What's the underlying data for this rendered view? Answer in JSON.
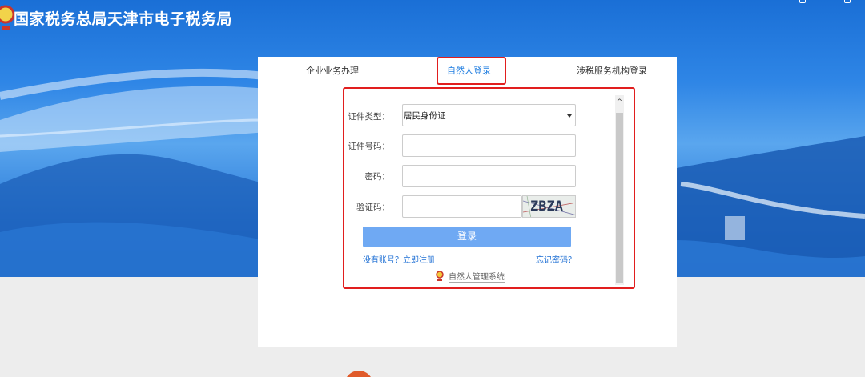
{
  "header": {
    "site_title": "国家税务总局天津市电子税务局"
  },
  "tabs": [
    {
      "label": "企业业务办理"
    },
    {
      "label": "自然人登录",
      "selected": true
    },
    {
      "label": "涉税服务机构登录"
    }
  ],
  "form": {
    "id_type_label": "证件类型：",
    "id_type_value": "居民身份证",
    "id_number_label": "证件号码：",
    "id_number_value": "",
    "password_label": "密码：",
    "password_value": "",
    "captcha_label": "验证码：",
    "captcha_value": "",
    "captcha_text": "ZBZA",
    "login_button": "登录",
    "register_link": "没有账号？立即注册",
    "forgot_link": "忘记密码？",
    "system_link": "自然人管理系统"
  },
  "colors": {
    "accent": "#1f7de0",
    "login_button": "#6fa9f3",
    "highlight_border": "#e11e1e"
  },
  "icons": [
    "tax-emblem-icon",
    "phone-icon",
    "chevron-up-icon",
    "chevron-down-icon"
  ]
}
